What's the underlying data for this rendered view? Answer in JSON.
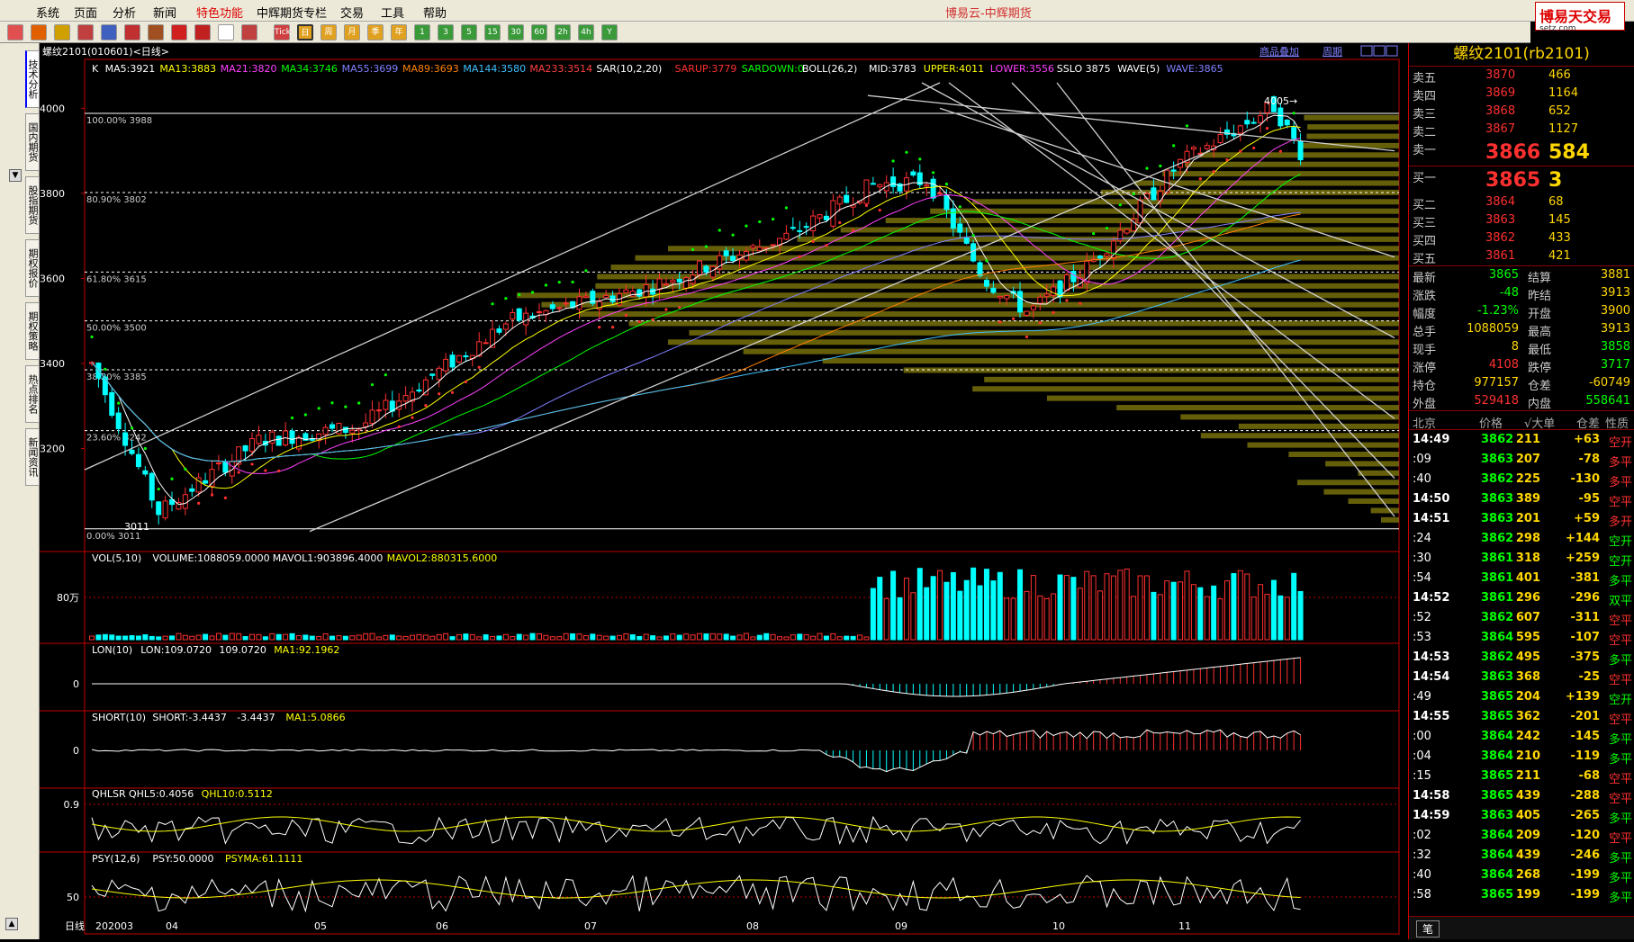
{
  "menu": {
    "items": [
      "系统",
      "页面",
      "分析",
      "新闻",
      "特色功能",
      "中辉期货专栏",
      "交易",
      "工具",
      "帮助"
    ],
    "title": "博易云-中辉期货",
    "logo": "博易天交易",
    "logo_sub": "setz.com"
  },
  "toolbar": {
    "labels": [
      "Tick",
      "日",
      "周",
      "月",
      "季",
      "年",
      "1",
      "3",
      "5",
      "15",
      "30",
      "60",
      "2h",
      "4h",
      "Y"
    ]
  },
  "left_tabs": [
    "技术分析",
    "国内期货",
    "股指期货",
    "期权报价",
    "期权策略",
    "热点排名",
    "新闻资讯"
  ],
  "chart": {
    "title": "螺纹2101(010601)<日线>",
    "top_links": [
      "商品叠加",
      "周期"
    ],
    "ma_legend": [
      {
        "t": "K",
        "c": "#ffffff"
      },
      {
        "t": "MA5:3921",
        "c": "#ffffff"
      },
      {
        "t": "MA13:3883",
        "c": "#ffff00"
      },
      {
        "t": "MA21:3820",
        "c": "#ff40ff"
      },
      {
        "t": "MA34:3746",
        "c": "#00ff00"
      },
      {
        "t": "MA55:3699",
        "c": "#8080ff"
      },
      {
        "t": "MA89:3693",
        "c": "#ff8000"
      },
      {
        "t": "MA144:3580",
        "c": "#40c0ff"
      },
      {
        "t": "MA233:3514",
        "c": "#ff4040"
      },
      {
        "t": "SAR(10,2,20)",
        "c": "#ffffff"
      },
      {
        "t": "SARUP:3779",
        "c": "#ff3030"
      },
      {
        "t": "SARDOWN:0",
        "c": "#00ff00"
      },
      {
        "t": "BOLL(26,2)",
        "c": "#ffffff"
      },
      {
        "t": "MID:3783",
        "c": "#ffffff"
      },
      {
        "t": "UPPER:4011",
        "c": "#ffff00"
      },
      {
        "t": "LOWER:3556",
        "c": "#ff40ff"
      },
      {
        "t": "SSLO 3875",
        "c": "#ffffff"
      },
      {
        "t": "WAVE(5)",
        "c": "#ffffff"
      },
      {
        "t": "WAVE:3865",
        "c": "#8080ff"
      }
    ],
    "price_axis": [
      "4000",
      "3800",
      "3600",
      "3400",
      "3200"
    ],
    "fib_labels": [
      "100.00% 3988",
      "80.90% 3802",
      "61.80% 3615",
      "50.00% 3500",
      "38.20% 3385",
      "23.60% 3242",
      "0.00% 3011"
    ],
    "high_label": "4005",
    "low_label": "3011",
    "vol_legend": [
      {
        "t": "VOL(5,10)",
        "c": "#ffffff"
      },
      {
        "t": "VOLUME:1088059.0000",
        "c": "#ffffff"
      },
      {
        "t": "MAVOL1:903896.4000",
        "c": "#ffffff"
      },
      {
        "t": "MAVOL2:880315.6000",
        "c": "#ffff00"
      }
    ],
    "vol_axis": "80万",
    "lon_legend": [
      {
        "t": "LON(10)",
        "c": "#ffffff"
      },
      {
        "t": "LON:109.0720",
        "c": "#ffffff"
      },
      {
        "t": "109.0720",
        "c": "#ffffff"
      },
      {
        "t": "MA1:92.1962",
        "c": "#ffff00"
      }
    ],
    "lon_axis": "0",
    "short_legend": [
      {
        "t": "SHORT(10)",
        "c": "#ffffff"
      },
      {
        "t": "SHORT:-3.4437",
        "c": "#ffffff"
      },
      {
        "t": "-3.4437",
        "c": "#ffffff"
      },
      {
        "t": "MA1:5.0866",
        "c": "#ffff00"
      }
    ],
    "short_axis": "0",
    "qhl_legend": [
      {
        "t": "QHLSR",
        "c": "#ffffff"
      },
      {
        "t": "QHL5:0.4056",
        "c": "#ffffff"
      },
      {
        "t": "QHL10:0.5112",
        "c": "#ffff00"
      }
    ],
    "qhl_axis": "0.9",
    "psy_legend": [
      {
        "t": "PSY(12,6)",
        "c": "#ffffff"
      },
      {
        "t": "PSY:50.0000",
        "c": "#ffffff"
      },
      {
        "t": "PSYMA:61.1111",
        "c": "#ffff00"
      }
    ],
    "psy_axis": "50",
    "date_axis": [
      "日线",
      "202003",
      "04",
      "05",
      "06",
      "07",
      "08",
      "09",
      "10",
      "11"
    ]
  },
  "quote": {
    "title": "螺纹2101(rb2101)",
    "asks": [
      {
        "l": "卖五",
        "p": "3870",
        "v": "466"
      },
      {
        "l": "卖四",
        "p": "3869",
        "v": "1164"
      },
      {
        "l": "卖三",
        "p": "3868",
        "v": "652"
      },
      {
        "l": "卖二",
        "p": "3867",
        "v": "1127"
      },
      {
        "l": "卖一",
        "p": "3866",
        "v": "584"
      }
    ],
    "bids": [
      {
        "l": "买一",
        "p": "3865",
        "v": "3"
      },
      {
        "l": "买二",
        "p": "3864",
        "v": "68"
      },
      {
        "l": "买三",
        "p": "3863",
        "v": "145"
      },
      {
        "l": "买四",
        "p": "3862",
        "v": "433"
      },
      {
        "l": "买五",
        "p": "3861",
        "v": "421"
      }
    ],
    "stats": [
      {
        "l1": "最新",
        "v1": "3865",
        "c1": "#00ff00",
        "l2": "结算",
        "v2": "3881",
        "c2": "#ffd700"
      },
      {
        "l1": "涨跌",
        "v1": "-48",
        "c1": "#00ff00",
        "l2": "昨结",
        "v2": "3913",
        "c2": "#ffd700"
      },
      {
        "l1": "幅度",
        "v1": "-1.23%",
        "c1": "#00ff00",
        "l2": "开盘",
        "v2": "3900",
        "c2": "#ffd700"
      },
      {
        "l1": "总手",
        "v1": "1088059",
        "c1": "#ffd700",
        "l2": "最高",
        "v2": "3913",
        "c2": "#ffd700"
      },
      {
        "l1": "现手",
        "v1": "8",
        "c1": "#ffd700",
        "l2": "最低",
        "v2": "3858",
        "c2": "#00ff00"
      },
      {
        "l1": "涨停",
        "v1": "4108",
        "c1": "#ff3030",
        "l2": "跌停",
        "v2": "3717",
        "c2": "#00ff00"
      },
      {
        "l1": "持仓",
        "v1": "977157",
        "c1": "#ffd700",
        "l2": "仓差",
        "v2": "-60749",
        "c2": "#ffd700"
      },
      {
        "l1": "外盘",
        "v1": "529418",
        "c1": "#ff3030",
        "l2": "内盘",
        "v2": "558641",
        "c2": "#00ff00"
      }
    ],
    "trade_header": [
      "北京",
      "价格",
      "√大单",
      "仓差",
      "性质"
    ],
    "trades": [
      {
        "t": "14:49",
        "b": true,
        "p": "3862",
        "v": "211",
        "d": "+63",
        "n": "空开",
        "nc": "#ff3030"
      },
      {
        "t": ":09",
        "b": false,
        "p": "3863",
        "v": "207",
        "d": "-78",
        "n": "多平",
        "nc": "#ff3030"
      },
      {
        "t": ":40",
        "b": false,
        "p": "3862",
        "v": "225",
        "d": "-130",
        "n": "多平",
        "nc": "#ff3030"
      },
      {
        "t": "14:50",
        "b": true,
        "p": "3863",
        "v": "389",
        "d": "-95",
        "n": "空平",
        "nc": "#ff3030"
      },
      {
        "t": "14:51",
        "b": true,
        "p": "3863",
        "v": "201",
        "d": "+59",
        "n": "多开",
        "nc": "#ff3030"
      },
      {
        "t": ":24",
        "b": false,
        "p": "3862",
        "v": "298",
        "d": "+144",
        "n": "空开",
        "nc": "#00ff00"
      },
      {
        "t": ":30",
        "b": false,
        "p": "3861",
        "v": "318",
        "d": "+259",
        "n": "空开",
        "nc": "#00ff00"
      },
      {
        "t": ":54",
        "b": false,
        "p": "3861",
        "v": "401",
        "d": "-381",
        "n": "多平",
        "nc": "#00ff00"
      },
      {
        "t": "14:52",
        "b": true,
        "p": "3861",
        "v": "296",
        "d": "-296",
        "n": "双平",
        "nc": "#00ff00"
      },
      {
        "t": ":52",
        "b": false,
        "p": "3862",
        "v": "607",
        "d": "-311",
        "n": "空平",
        "nc": "#ff3030"
      },
      {
        "t": ":53",
        "b": false,
        "p": "3864",
        "v": "595",
        "d": "-107",
        "n": "空平",
        "nc": "#ff3030"
      },
      {
        "t": "14:53",
        "b": true,
        "p": "3862",
        "v": "495",
        "d": "-375",
        "n": "多平",
        "nc": "#00ff00"
      },
      {
        "t": "14:54",
        "b": true,
        "p": "3863",
        "v": "368",
        "d": "-25",
        "n": "空平",
        "nc": "#ff3030"
      },
      {
        "t": ":49",
        "b": false,
        "p": "3865",
        "v": "204",
        "d": "+139",
        "n": "空开",
        "nc": "#00ff00"
      },
      {
        "t": "14:55",
        "b": true,
        "p": "3865",
        "v": "362",
        "d": "-201",
        "n": "空平",
        "nc": "#ff3030"
      },
      {
        "t": ":00",
        "b": false,
        "p": "3864",
        "v": "242",
        "d": "-145",
        "n": "多平",
        "nc": "#00ff00"
      },
      {
        "t": ":04",
        "b": false,
        "p": "3864",
        "v": "210",
        "d": "-119",
        "n": "多平",
        "nc": "#00ff00"
      },
      {
        "t": ":15",
        "b": false,
        "p": "3865",
        "v": "211",
        "d": "-68",
        "n": "空平",
        "nc": "#ff3030"
      },
      {
        "t": "14:58",
        "b": true,
        "p": "3865",
        "v": "439",
        "d": "-288",
        "n": "空平",
        "nc": "#ff3030"
      },
      {
        "t": "14:59",
        "b": true,
        "p": "3863",
        "v": "405",
        "d": "-265",
        "n": "多平",
        "nc": "#00ff00"
      },
      {
        "t": ":02",
        "b": false,
        "p": "3864",
        "v": "209",
        "d": "-120",
        "n": "空平",
        "nc": "#ff3030"
      },
      {
        "t": ":32",
        "b": false,
        "p": "3864",
        "v": "439",
        "d": "-246",
        "n": "多平",
        "nc": "#00ff00"
      },
      {
        "t": ":40",
        "b": false,
        "p": "3864",
        "v": "268",
        "d": "-199",
        "n": "多平",
        "nc": "#00ff00"
      },
      {
        "t": ":58",
        "b": false,
        "p": "3865",
        "v": "199",
        "d": "-199",
        "n": "多平",
        "nc": "#00ff00"
      }
    ],
    "bottom_tab": "笔"
  }
}
